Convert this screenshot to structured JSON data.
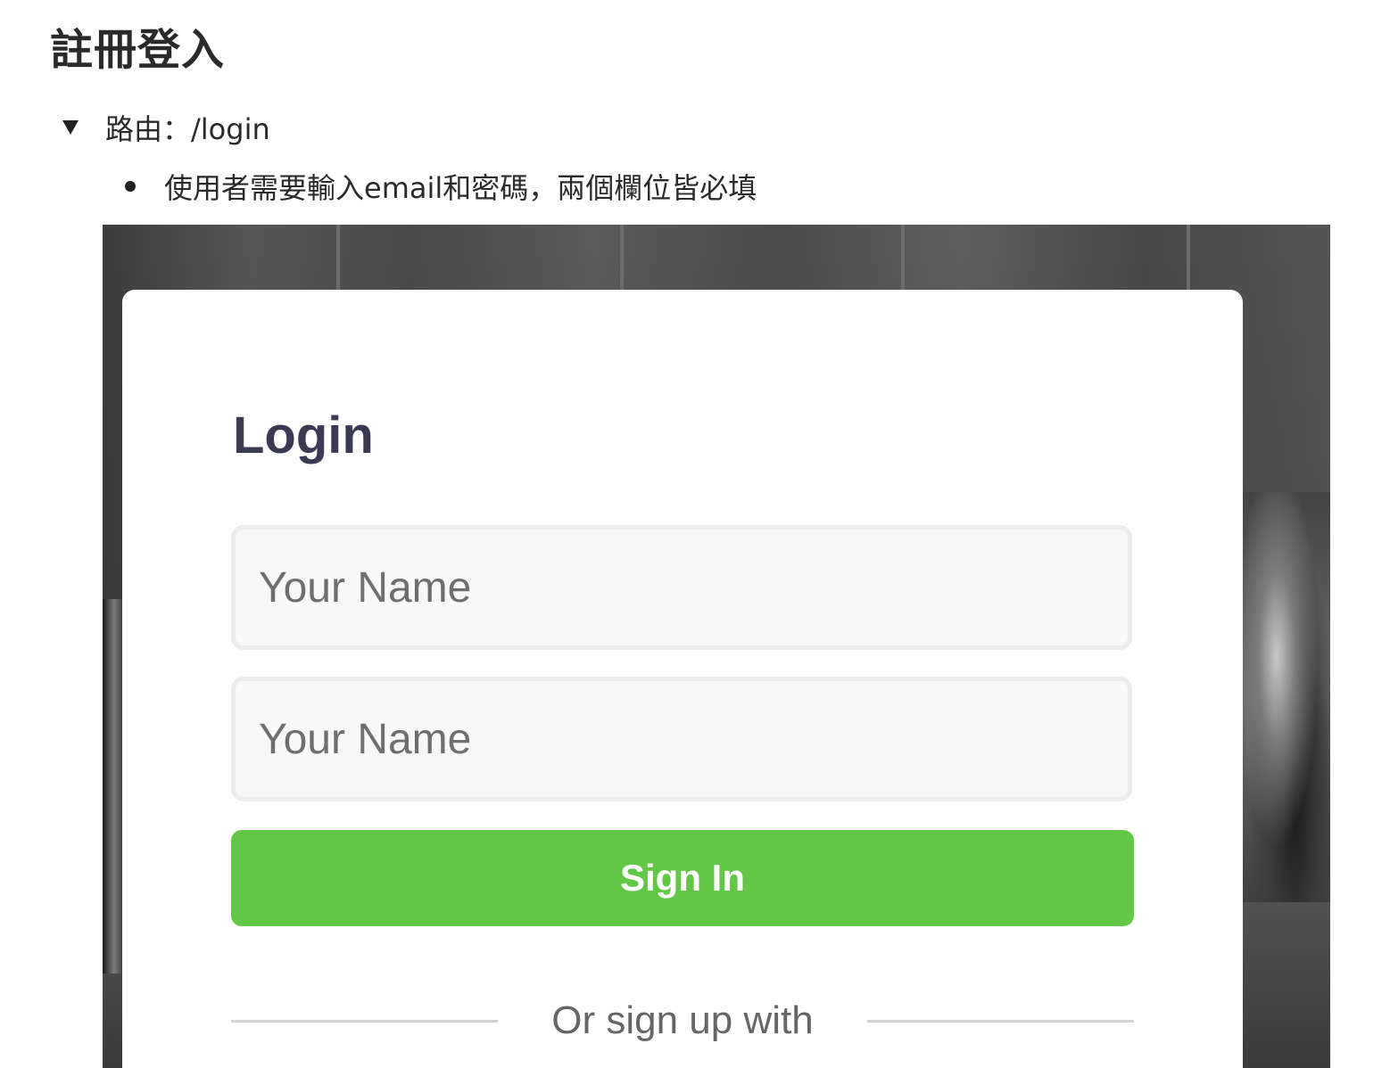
{
  "doc": {
    "title": "註冊登入",
    "route": "路由：/login",
    "bullet": "使用者需要輸入email和密碼，兩個欄位皆必填"
  },
  "mockup": {
    "login_title": "Login",
    "field1_placeholder": "Your Name",
    "field2_placeholder": "Your Name",
    "sign_in_label": "Sign In",
    "divider_text": "Or sign up with"
  },
  "colors": {
    "button_green": "#62c744",
    "title_navy": "#3a3b52"
  }
}
